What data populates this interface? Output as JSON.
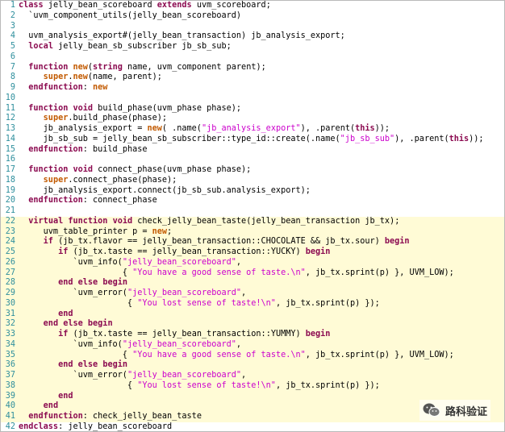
{
  "editor": {
    "highlight_range": [
      22,
      41
    ],
    "lines": [
      {
        "n": "1",
        "tokens": [
          {
            "t": "class",
            "c": "k"
          },
          {
            "t": " jelly_bean_scoreboard ",
            "c": "t"
          },
          {
            "t": "extends",
            "c": "k"
          },
          {
            "t": " uvm_scoreboard;",
            "c": "t"
          }
        ]
      },
      {
        "n": "2",
        "tokens": [
          {
            "t": "  `uvm_component_utils(jelly_bean_scoreboard)",
            "c": "t"
          }
        ]
      },
      {
        "n": "3",
        "tokens": []
      },
      {
        "n": "4",
        "tokens": [
          {
            "t": "  uvm_analysis_export#(jelly_bean_transaction) jb_analysis_export;",
            "c": "t"
          }
        ]
      },
      {
        "n": "5",
        "tokens": [
          {
            "t": "  ",
            "c": "t"
          },
          {
            "t": "local",
            "c": "k"
          },
          {
            "t": " jelly_bean_sb_subscriber jb_sb_sub;",
            "c": "t"
          }
        ]
      },
      {
        "n": "6",
        "tokens": []
      },
      {
        "n": "7",
        "tokens": [
          {
            "t": "  ",
            "c": "t"
          },
          {
            "t": "function",
            "c": "k"
          },
          {
            "t": " ",
            "c": "t"
          },
          {
            "t": "new",
            "c": "o"
          },
          {
            "t": "(",
            "c": "t"
          },
          {
            "t": "string",
            "c": "k"
          },
          {
            "t": " name, uvm_component parent);",
            "c": "t"
          }
        ]
      },
      {
        "n": "8",
        "tokens": [
          {
            "t": "     ",
            "c": "t"
          },
          {
            "t": "super",
            "c": "o"
          },
          {
            "t": ".",
            "c": "t"
          },
          {
            "t": "new",
            "c": "o"
          },
          {
            "t": "(name, parent);",
            "c": "t"
          }
        ]
      },
      {
        "n": "9",
        "tokens": [
          {
            "t": "  ",
            "c": "t"
          },
          {
            "t": "endfunction",
            "c": "k"
          },
          {
            "t": ": ",
            "c": "t"
          },
          {
            "t": "new",
            "c": "o"
          }
        ]
      },
      {
        "n": "10",
        "tokens": []
      },
      {
        "n": "11",
        "tokens": [
          {
            "t": "  ",
            "c": "t"
          },
          {
            "t": "function",
            "c": "k"
          },
          {
            "t": " ",
            "c": "t"
          },
          {
            "t": "void",
            "c": "k"
          },
          {
            "t": " build_phase(uvm_phase phase);",
            "c": "t"
          }
        ]
      },
      {
        "n": "12",
        "tokens": [
          {
            "t": "     ",
            "c": "t"
          },
          {
            "t": "super",
            "c": "o"
          },
          {
            "t": ".build_phase(phase);",
            "c": "t"
          }
        ]
      },
      {
        "n": "13",
        "tokens": [
          {
            "t": "     jb_analysis_export = ",
            "c": "t"
          },
          {
            "t": "new",
            "c": "o"
          },
          {
            "t": "( .name(",
            "c": "t"
          },
          {
            "t": "\"jb_analysis_export\"",
            "c": "s"
          },
          {
            "t": "), .parent(",
            "c": "t"
          },
          {
            "t": "this",
            "c": "k"
          },
          {
            "t": "));",
            "c": "t"
          }
        ]
      },
      {
        "n": "14",
        "tokens": [
          {
            "t": "     jb_sb_sub = jelly_bean_sb_subscriber::type_id::create(.name(",
            "c": "t"
          },
          {
            "t": "\"jb_sb_sub\"",
            "c": "s"
          },
          {
            "t": "), .parent(",
            "c": "t"
          },
          {
            "t": "this",
            "c": "k"
          },
          {
            "t": "));",
            "c": "t"
          }
        ]
      },
      {
        "n": "15",
        "tokens": [
          {
            "t": "  ",
            "c": "t"
          },
          {
            "t": "endfunction",
            "c": "k"
          },
          {
            "t": ": build_phase",
            "c": "t"
          }
        ]
      },
      {
        "n": "16",
        "tokens": []
      },
      {
        "n": "17",
        "tokens": [
          {
            "t": "  ",
            "c": "t"
          },
          {
            "t": "function",
            "c": "k"
          },
          {
            "t": " ",
            "c": "t"
          },
          {
            "t": "void",
            "c": "k"
          },
          {
            "t": " connect_phase(uvm_phase phase);",
            "c": "t"
          }
        ]
      },
      {
        "n": "18",
        "tokens": [
          {
            "t": "     ",
            "c": "t"
          },
          {
            "t": "super",
            "c": "o"
          },
          {
            "t": ".connect_phase(phase);",
            "c": "t"
          }
        ]
      },
      {
        "n": "19",
        "tokens": [
          {
            "t": "     jb_analysis_export.connect(jb_sb_sub.analysis_export);",
            "c": "t"
          }
        ]
      },
      {
        "n": "20",
        "tokens": [
          {
            "t": "  ",
            "c": "t"
          },
          {
            "t": "endfunction",
            "c": "k"
          },
          {
            "t": ": connect_phase",
            "c": "t"
          }
        ]
      },
      {
        "n": "21",
        "tokens": []
      },
      {
        "n": "22",
        "tokens": [
          {
            "t": "  ",
            "c": "t"
          },
          {
            "t": "virtual",
            "c": "k"
          },
          {
            "t": " ",
            "c": "t"
          },
          {
            "t": "function",
            "c": "k"
          },
          {
            "t": " ",
            "c": "t"
          },
          {
            "t": "void",
            "c": "k"
          },
          {
            "t": " check_jelly_bean_taste(jelly_bean_transaction jb_tx);",
            "c": "t"
          }
        ]
      },
      {
        "n": "23",
        "tokens": [
          {
            "t": "     uvm_table_printer p = ",
            "c": "t"
          },
          {
            "t": "new",
            "c": "o"
          },
          {
            "t": ";",
            "c": "t"
          }
        ]
      },
      {
        "n": "24",
        "tokens": [
          {
            "t": "     ",
            "c": "t"
          },
          {
            "t": "if",
            "c": "k"
          },
          {
            "t": " (jb_tx.flavor == jelly_bean_transaction::CHOCOLATE && jb_tx.sour) ",
            "c": "t"
          },
          {
            "t": "begin",
            "c": "k"
          }
        ]
      },
      {
        "n": "25",
        "tokens": [
          {
            "t": "        ",
            "c": "t"
          },
          {
            "t": "if",
            "c": "k"
          },
          {
            "t": " (jb_tx.taste == jelly_bean_transaction::YUCKY) ",
            "c": "t"
          },
          {
            "t": "begin",
            "c": "k"
          }
        ]
      },
      {
        "n": "26",
        "tokens": [
          {
            "t": "           `uvm_info(",
            "c": "t"
          },
          {
            "t": "\"jelly_bean_scoreboard\"",
            "c": "s"
          },
          {
            "t": ",",
            "c": "t"
          }
        ]
      },
      {
        "n": "27",
        "tokens": [
          {
            "t": "                     { ",
            "c": "t"
          },
          {
            "t": "\"You have a good sense of taste.\\n\"",
            "c": "s"
          },
          {
            "t": ", jb_tx.sprint(p) }, UVM_LOW);",
            "c": "t"
          }
        ]
      },
      {
        "n": "28",
        "tokens": [
          {
            "t": "        ",
            "c": "t"
          },
          {
            "t": "end",
            "c": "k"
          },
          {
            "t": " ",
            "c": "t"
          },
          {
            "t": "else",
            "c": "k"
          },
          {
            "t": " ",
            "c": "t"
          },
          {
            "t": "begin",
            "c": "k"
          }
        ]
      },
      {
        "n": "29",
        "tokens": [
          {
            "t": "           `uvm_error(",
            "c": "t"
          },
          {
            "t": "\"jelly_bean_scoreboard\"",
            "c": "s"
          },
          {
            "t": ",",
            "c": "t"
          }
        ]
      },
      {
        "n": "30",
        "tokens": [
          {
            "t": "                      { ",
            "c": "t"
          },
          {
            "t": "\"You lost sense of taste!\\n\"",
            "c": "s"
          },
          {
            "t": ", jb_tx.sprint(p) });",
            "c": "t"
          }
        ]
      },
      {
        "n": "31",
        "tokens": [
          {
            "t": "        ",
            "c": "t"
          },
          {
            "t": "end",
            "c": "k"
          }
        ]
      },
      {
        "n": "32",
        "tokens": [
          {
            "t": "     ",
            "c": "t"
          },
          {
            "t": "end",
            "c": "k"
          },
          {
            "t": " ",
            "c": "t"
          },
          {
            "t": "else",
            "c": "k"
          },
          {
            "t": " ",
            "c": "t"
          },
          {
            "t": "begin",
            "c": "k"
          }
        ]
      },
      {
        "n": "33",
        "tokens": [
          {
            "t": "        ",
            "c": "t"
          },
          {
            "t": "if",
            "c": "k"
          },
          {
            "t": " (jb_tx.taste == jelly_bean_transaction::YUMMY) ",
            "c": "t"
          },
          {
            "t": "begin",
            "c": "k"
          }
        ]
      },
      {
        "n": "34",
        "tokens": [
          {
            "t": "           `uvm_info(",
            "c": "t"
          },
          {
            "t": "\"jelly_bean_scoreboard\"",
            "c": "s"
          },
          {
            "t": ",",
            "c": "t"
          }
        ]
      },
      {
        "n": "35",
        "tokens": [
          {
            "t": "                     { ",
            "c": "t"
          },
          {
            "t": "\"You have a good sense of taste.\\n\"",
            "c": "s"
          },
          {
            "t": ", jb_tx.sprint(p) }, UVM_LOW);",
            "c": "t"
          }
        ]
      },
      {
        "n": "36",
        "tokens": [
          {
            "t": "        ",
            "c": "t"
          },
          {
            "t": "end",
            "c": "k"
          },
          {
            "t": " ",
            "c": "t"
          },
          {
            "t": "else",
            "c": "k"
          },
          {
            "t": " ",
            "c": "t"
          },
          {
            "t": "begin",
            "c": "k"
          }
        ]
      },
      {
        "n": "37",
        "tokens": [
          {
            "t": "           `uvm_error(",
            "c": "t"
          },
          {
            "t": "\"jelly_bean_scoreboard\"",
            "c": "s"
          },
          {
            "t": ",",
            "c": "t"
          }
        ]
      },
      {
        "n": "38",
        "tokens": [
          {
            "t": "                      { ",
            "c": "t"
          },
          {
            "t": "\"You lost sense of taste!\\n\"",
            "c": "s"
          },
          {
            "t": ", jb_tx.sprint(p) });",
            "c": "t"
          }
        ]
      },
      {
        "n": "39",
        "tokens": [
          {
            "t": "        ",
            "c": "t"
          },
          {
            "t": "end",
            "c": "k"
          }
        ]
      },
      {
        "n": "40",
        "tokens": [
          {
            "t": "     ",
            "c": "t"
          },
          {
            "t": "end",
            "c": "k"
          }
        ]
      },
      {
        "n": "41",
        "tokens": [
          {
            "t": "  ",
            "c": "t"
          },
          {
            "t": "endfunction",
            "c": "k"
          },
          {
            "t": ": check_jelly_bean_taste",
            "c": "t"
          }
        ]
      },
      {
        "n": "42",
        "tokens": [
          {
            "t": "endclass",
            "c": "k"
          },
          {
            "t": ": jelly_bean_scoreboard",
            "c": "t"
          }
        ]
      }
    ]
  },
  "watermark": {
    "text": "路科验证",
    "icon": "wechat-icon"
  }
}
